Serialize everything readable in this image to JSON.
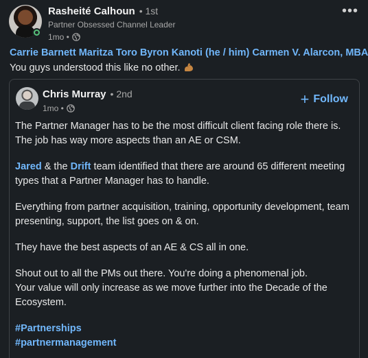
{
  "post": {
    "author": {
      "name": "Rasheité Calhoun",
      "degree": "• 1st",
      "headline": "Partner Obsessed Channel Leader",
      "time": "1mo •"
    },
    "more_label": "•••",
    "mentions": "Carrie Barnett Maritza Toro Byron Kanoti (he / him) Carmen V. Alarcon, MBA",
    "caption": "You guys understood this like no other.",
    "caption_emoji": "flexed-biceps-icon"
  },
  "shared": {
    "author": {
      "name": "Chris Murray",
      "degree": "• 2nd",
      "time": "1mo •"
    },
    "follow_label": "Follow",
    "paragraphs": [
      "The Partner Manager has to be the most difficult client facing role there is. The job has way more aspects than an AE or CSM.",
      "team identified that there are around 65 different meeting types that a Partner Manager has to handle.",
      "Everything from partner acquisition, training, opportunity development, team presenting, support, the list goes on & on.",
      "They have the best aspects of an AE & CS all in one.",
      "Shout out to all the PMs out there. You're doing a phenomenal job.",
      "Your value will only increase as we move further into the Decade of the Ecosystem."
    ],
    "mention_jared": "Jared",
    "mention_between": " & the ",
    "mention_drift": "Drift",
    "hashtags": [
      "#Partnerships",
      "#partnermanagement"
    ]
  },
  "colors": {
    "background": "#1b1f23",
    "link": "#71b7fb",
    "text": "#e8e8e8",
    "muted": "#a8a8a8",
    "online": "#57c27a"
  }
}
